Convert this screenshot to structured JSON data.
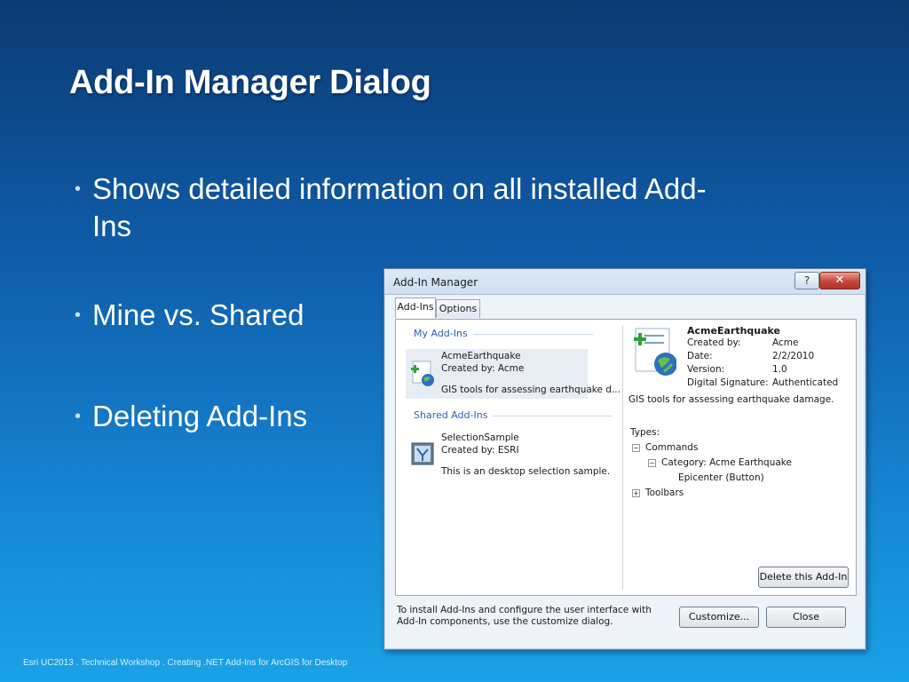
{
  "slide": {
    "title": "Add-In Manager Dialog",
    "bullets": [
      "Shows detailed information on all installed Add-Ins",
      "Mine vs. Shared",
      "Deleting Add-Ins"
    ],
    "footer": "Esri UC2013 . Technical Workshop . Creating .NET Add-Ins for ArcGIS for Desktop"
  },
  "dialog": {
    "title": "Add-In Manager",
    "help_label": "?",
    "close_glyph": "✕",
    "tabs": [
      "Add-Ins",
      "Options"
    ],
    "groups": {
      "mine": "My Add-Ins",
      "shared": "Shared Add-Ins"
    },
    "addins": [
      {
        "name": "AcmeEarthquake",
        "created_by": "Created by: Acme",
        "description": "GIS tools for assessing earthquake d..."
      },
      {
        "name": "SelectionSample",
        "created_by": "Created by: ESRI",
        "description": "This is an desktop selection sample."
      }
    ],
    "details": {
      "name": "AcmeEarthquake",
      "fields": [
        {
          "key": "Created by:",
          "value": "Acme"
        },
        {
          "key": "Date:",
          "value": "2/2/2010"
        },
        {
          "key": "Version:",
          "value": "1.0"
        },
        {
          "key": "Digital Signature:",
          "value": "Authenticated"
        }
      ],
      "description": "GIS tools for assessing earthquake damage.",
      "types_label": "Types:",
      "tree": {
        "commands": "Commands",
        "category": "Category: Acme Earthquake",
        "epicenter": "Epicenter (Button)",
        "toolbars": "Toolbars",
        "collapse_glyph": "−",
        "expand_glyph": "+"
      }
    },
    "delete_button": "Delete this Add-In",
    "install_info": "To install Add-Ins and configure the user interface with Add-In components, use the customize dialog.",
    "customize_button": "Customize...",
    "close_button": "Close"
  },
  "colors": {
    "background_top": "#0b3b74",
    "background_bottom": "#1aa2e6",
    "group_header": "#2a61b4",
    "close_button": "#c6463a"
  },
  "icons": [
    "addin-plus-globe-icon",
    "selection-sample-icon",
    "help-icon",
    "close-icon"
  ]
}
